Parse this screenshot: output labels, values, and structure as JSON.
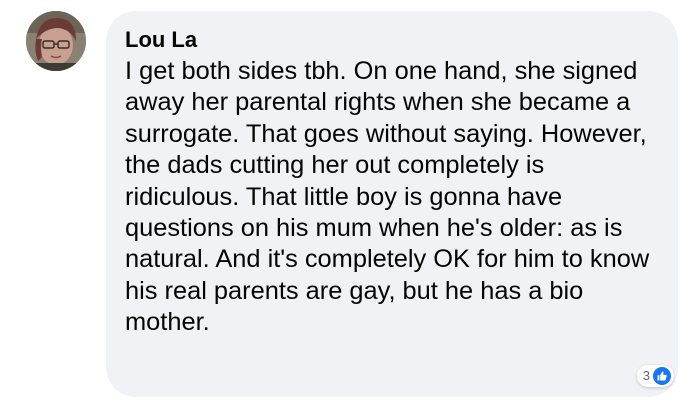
{
  "comment": {
    "author": "Lou La",
    "text": "I get both sides tbh. On one hand, she signed away her parental rights when she became a surrogate. That goes without saying. However, the dads cutting her out completely is ridiculous. That little boy is gonna have questions on his mum when he's older: as is natural. And it's completely OK for him to know his real parents are gay, but he has a bio mother.",
    "reactions": {
      "count": "3",
      "icon": "like-icon",
      "color": "#1877f2"
    }
  },
  "colors": {
    "bubble_background": "#f0f2f5",
    "text": "#050505",
    "secondary_text": "#65676b"
  }
}
